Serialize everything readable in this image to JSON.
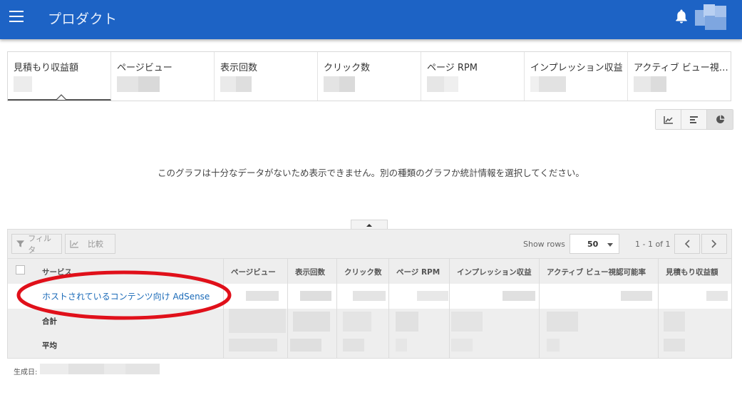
{
  "app": {
    "title": "プロダクト"
  },
  "metrics": [
    {
      "label": "見積もり収益額",
      "active": true
    },
    {
      "label": "ページビュー"
    },
    {
      "label": "表示回数"
    },
    {
      "label": "クリック数"
    },
    {
      "label": "ページ RPM"
    },
    {
      "label": "インプレッション収益"
    },
    {
      "label": "アクティブ ビュー視認..."
    }
  ],
  "chart": {
    "message": "このグラフは十分なデータがないため表示できません。別の種類のグラフか統計情報を選択してください。"
  },
  "toolbar": {
    "filter_label": "フィルタ",
    "compare_label": "比較",
    "show_rows_label": "Show rows",
    "rows_value": "50",
    "range_text": "1 - 1 of 1"
  },
  "table": {
    "headers": [
      "サービス",
      "ページビュー",
      "表示回数",
      "クリック数",
      "ページ RPM",
      "インプレッション収益",
      "アクティブ ビュー視認可能率",
      "見積もり収益額"
    ],
    "row_link": "ホストされているコンテンツ向け AdSense",
    "total_label": "合計",
    "average_label": "平均"
  },
  "footer": {
    "generated_label": "生成日:"
  },
  "colors": {
    "header_bg": "#1d63c5",
    "link": "#1a6ab8",
    "annotation": "#e0101a"
  }
}
